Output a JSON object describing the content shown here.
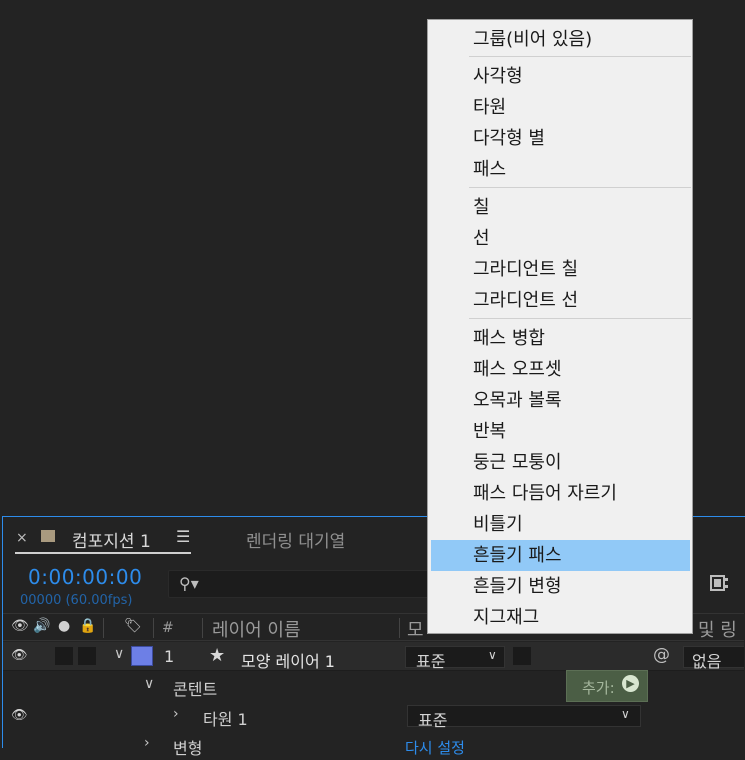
{
  "menu": {
    "items": [
      {
        "label": "그룹(비어 있음)",
        "group": 0
      },
      {
        "label": "사각형",
        "group": 1
      },
      {
        "label": "타원",
        "group": 1
      },
      {
        "label": "다각형 별",
        "group": 1
      },
      {
        "label": "패스",
        "group": 1
      },
      {
        "label": "칠",
        "group": 2
      },
      {
        "label": "선",
        "group": 2
      },
      {
        "label": "그라디언트 칠",
        "group": 2
      },
      {
        "label": "그라디언트 선",
        "group": 2
      },
      {
        "label": "패스 병합",
        "group": 3
      },
      {
        "label": "패스 오프셋",
        "group": 3
      },
      {
        "label": "오목과 볼록",
        "group": 3
      },
      {
        "label": "반복",
        "group": 3
      },
      {
        "label": "둥근 모퉁이",
        "group": 3
      },
      {
        "label": "패스 다듬어 자르기",
        "group": 3
      },
      {
        "label": "비틀기",
        "group": 3
      },
      {
        "label": "흔들기 패스",
        "group": 3,
        "highlighted": true
      },
      {
        "label": "흔들기 변형",
        "group": 3
      },
      {
        "label": "지그재그",
        "group": 3
      }
    ]
  },
  "tabs": {
    "close_glyph": "×",
    "comp_label": "컴포지션 1",
    "menu_glyph": "☰",
    "render_queue_label": "렌더링 대기열"
  },
  "timeline": {
    "timecode": "0:00:00:00",
    "fps": "00000 (60.00fps)",
    "search_icon": "magnifier-icon"
  },
  "columns": {
    "hash": "#",
    "layer_name": "레이어 이름",
    "mode": "모",
    "parent_partial": "및 링"
  },
  "layers": {
    "row1": {
      "index": "1",
      "star": "★",
      "name": "모양 레이어 1",
      "mode": "표준",
      "parent": "없음"
    },
    "contents_label": "콘텐트",
    "add_label": "추가:",
    "ellipse": {
      "name": "타원 1",
      "mode": "표준"
    },
    "transform_label": "변형",
    "reset_label": "다시 설정"
  },
  "colors": {
    "accent": "#2d8ceb",
    "menu_highlight": "#91c9f7",
    "layer_label": "#6d7fe6"
  }
}
